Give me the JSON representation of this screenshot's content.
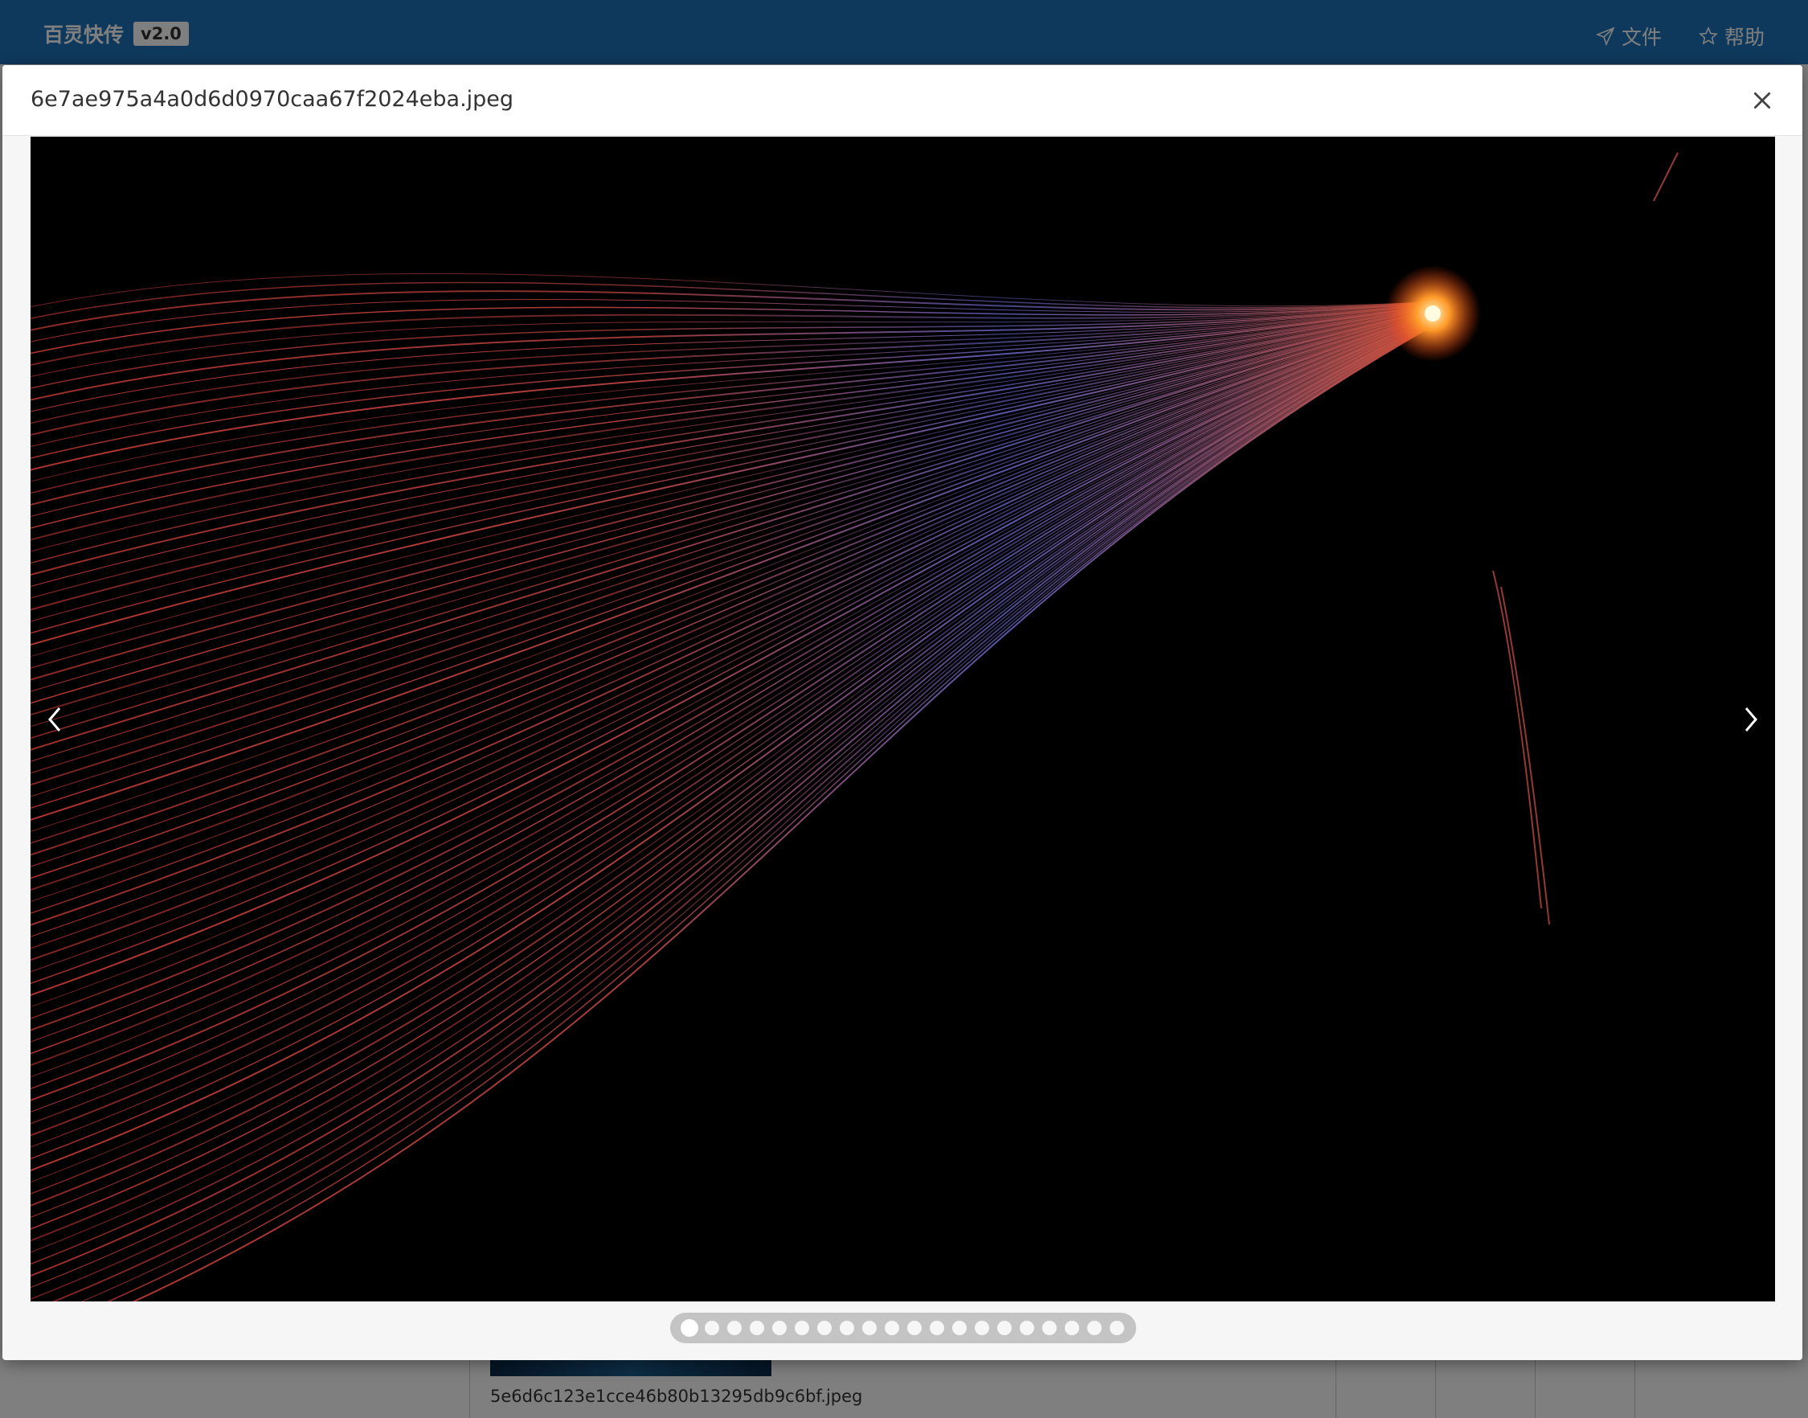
{
  "navbar": {
    "brand": "百灵快传",
    "version": "v2.0",
    "links": [
      {
        "label": "文件",
        "icon": "send-icon"
      },
      {
        "label": "帮助",
        "icon": "star-icon"
      }
    ],
    "color": "#1e73b8"
  },
  "background": {
    "file_name": "5e6d6c123e1cce46b80b13295db9c6bf.jpeg"
  },
  "modal": {
    "title": "6e7ae975a4a0d6d0970caa67f2024eba.jpeg",
    "close_icon": "close-icon",
    "carousel": {
      "prev_icon": "chevron-left-icon",
      "next_icon": "chevron-right-icon",
      "indicator_count": 20,
      "active_index": 0
    }
  }
}
